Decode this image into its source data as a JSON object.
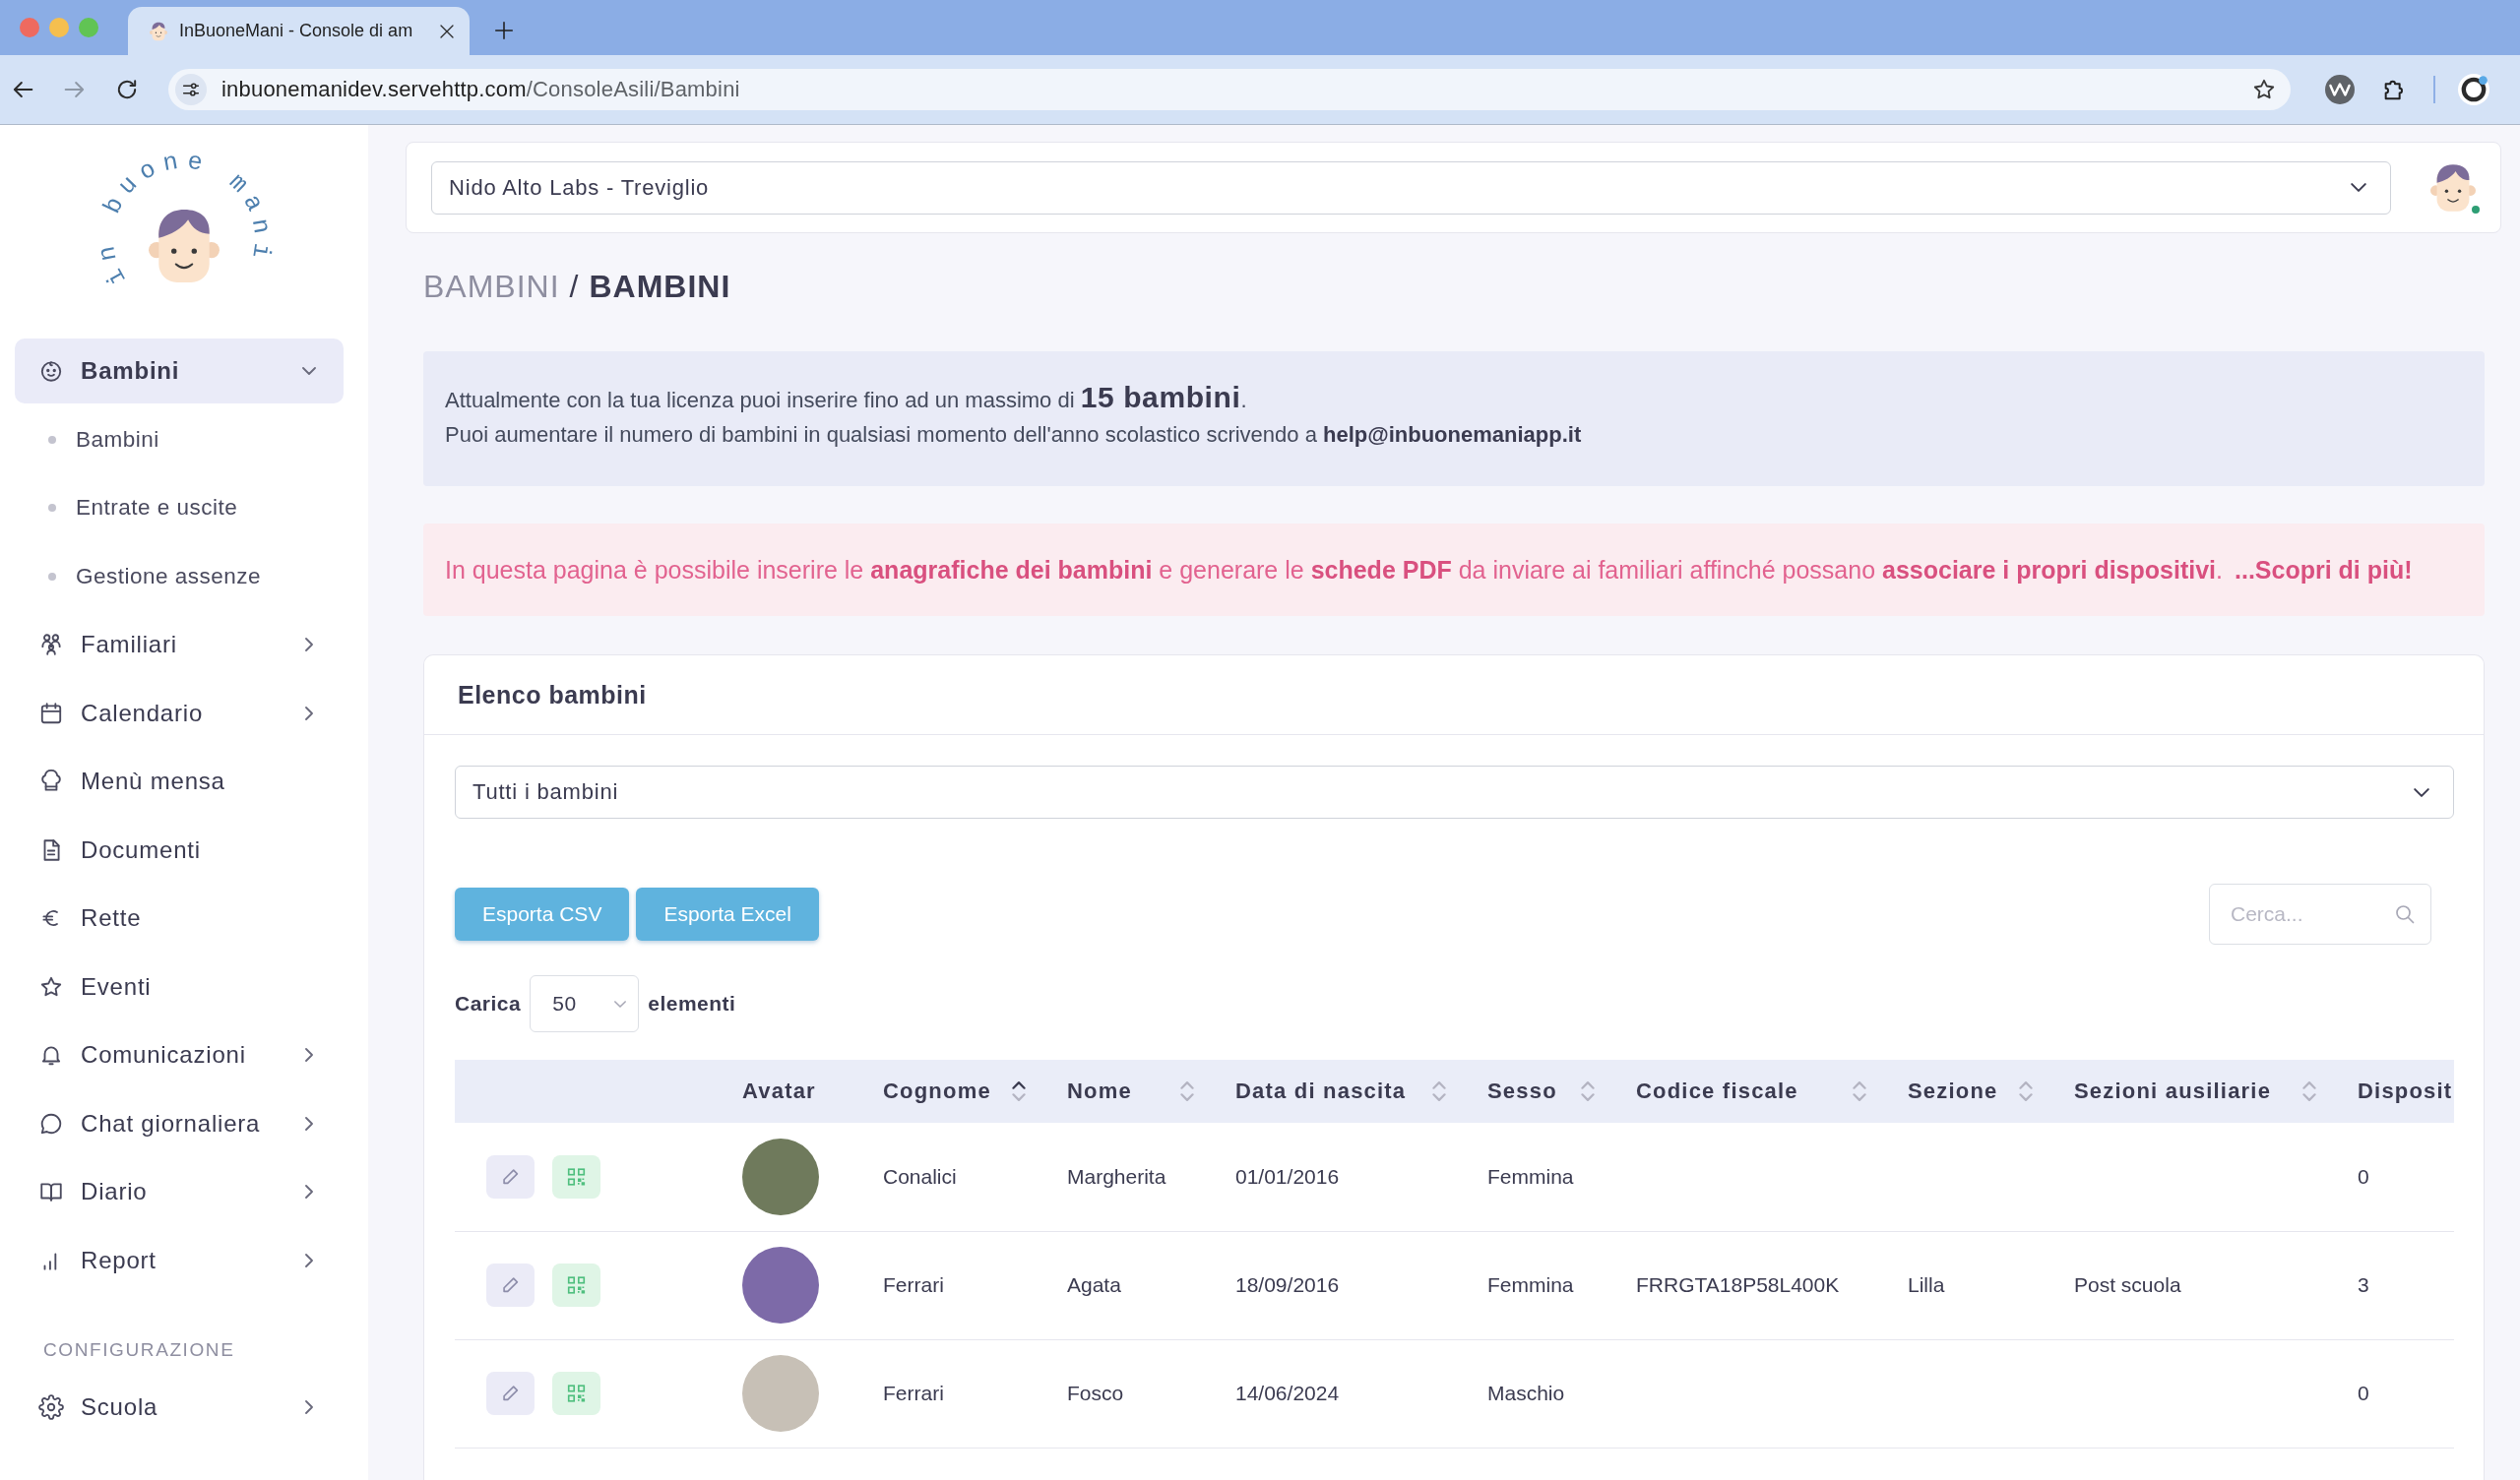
{
  "browser": {
    "tabs": [
      {
        "title": "InBuoneMani - Console di am",
        "selected": true
      }
    ],
    "back": {
      "disabled": false
    },
    "forward": {
      "disabled": true
    },
    "address": {
      "host": "inbuonemanidev.servehttp.com",
      "path": "/ConsoleAsili/Bambini"
    }
  },
  "sidebar": {
    "logo_text": "in buone mani",
    "sections": [
      {
        "items": [
          {
            "label": "Bambini",
            "kind": "group",
            "selected": true,
            "expanded": true,
            "children": [
              {
                "label": "Bambini",
                "selected": false
              },
              {
                "label": "Entrate e uscite",
                "selected": false
              },
              {
                "label": "Gestione assenze",
                "selected": false
              }
            ]
          },
          {
            "label": "Familiari",
            "kind": "group",
            "selected": false,
            "expanded": false
          },
          {
            "label": "Calendario",
            "kind": "group",
            "selected": false,
            "expanded": false
          },
          {
            "label": "Menù mensa",
            "kind": "link",
            "selected": false
          },
          {
            "label": "Documenti",
            "kind": "link",
            "selected": false
          },
          {
            "label": "Rette",
            "kind": "link",
            "selected": false
          },
          {
            "label": "Eventi",
            "kind": "link",
            "selected": false
          },
          {
            "label": "Comunicazioni",
            "kind": "group",
            "selected": false,
            "expanded": false
          },
          {
            "label": "Chat giornaliera",
            "kind": "group",
            "selected": false,
            "expanded": false
          },
          {
            "label": "Diario",
            "kind": "group",
            "selected": false,
            "expanded": false
          },
          {
            "label": "Report",
            "kind": "group",
            "selected": false,
            "expanded": false
          }
        ]
      },
      {
        "heading": "CONFIGURAZIONE",
        "items": [
          {
            "label": "Scuola",
            "kind": "group",
            "selected": false,
            "expanded": false
          }
        ]
      }
    ]
  },
  "header": {
    "school_select": {
      "value": "Nido Alto Labs - Treviglio"
    },
    "user": {
      "online": true
    }
  },
  "breadcrumb": {
    "items": [
      {
        "label": "BAMBINI",
        "current": false
      },
      {
        "label": "BAMBINI",
        "current": true
      }
    ],
    "separator": "/"
  },
  "license_info": {
    "lines": [
      {
        "kind": "emphasis",
        "text": "Attualmente con la tua licenza puoi inserire fino ad un massimo di **15 bambini**."
      },
      {
        "kind": "plain",
        "text": "Puoi aumentare il numero di bambini in qualsiasi momento dell'anno scolastico scrivendo a **help@inbuonemaniapp.it**"
      }
    ]
  },
  "notice": {
    "text": "In questa pagina è possibile inserire le **anagrafiche dei bambini** e generare le **schede PDF** da inviare ai familiari affinché possano **associare i propri dispositivi**.",
    "link": "...Scopri di più!"
  },
  "children_list": {
    "title": "Elenco bambini",
    "filter": {
      "value": "Tutti i bambini"
    },
    "export_buttons": [
      "Esporta CSV",
      "Esporta Excel"
    ],
    "search": {
      "placeholder": "Cerca..."
    },
    "page_length": {
      "label": "Carica",
      "value": "50",
      "suffix": "elementi"
    },
    "table": {
      "columns": [
        {
          "label": "Avatar"
        },
        {
          "label": "Cognome",
          "sorted": true
        },
        {
          "label": "Nome",
          "sorted": false
        },
        {
          "label": "Data di nascita",
          "sorted": false
        },
        {
          "label": "Sesso",
          "sorted": false
        },
        {
          "label": "Codice fiscale",
          "sorted": false
        },
        {
          "label": "Sezione",
          "sorted": false
        },
        {
          "label": "Sezioni ausiliarie",
          "sorted": false
        },
        {
          "label": "Disposit"
        }
      ],
      "rows": [
        {
          "cognome": "Conalici",
          "nome": "Margherita",
          "data_di_nascita": "01/01/2016",
          "sesso": "Femmina",
          "column_9": "0"
        },
        {
          "cognome": "Ferrari",
          "nome": "Agata",
          "data_di_nascita": "18/09/2016",
          "sesso": "Femmina",
          "codice_fiscale": "FRRGTA18P58L400K",
          "sezione": "Lilla",
          "sezioni_ausiliarie": "Post scuola",
          "column_9": "3"
        },
        {
          "cognome": "Ferrari",
          "nome": "Fosco",
          "data_di_nascita": "14/06/2024",
          "sesso": "Maschio",
          "column_9": "0"
        }
      ]
    }
  }
}
